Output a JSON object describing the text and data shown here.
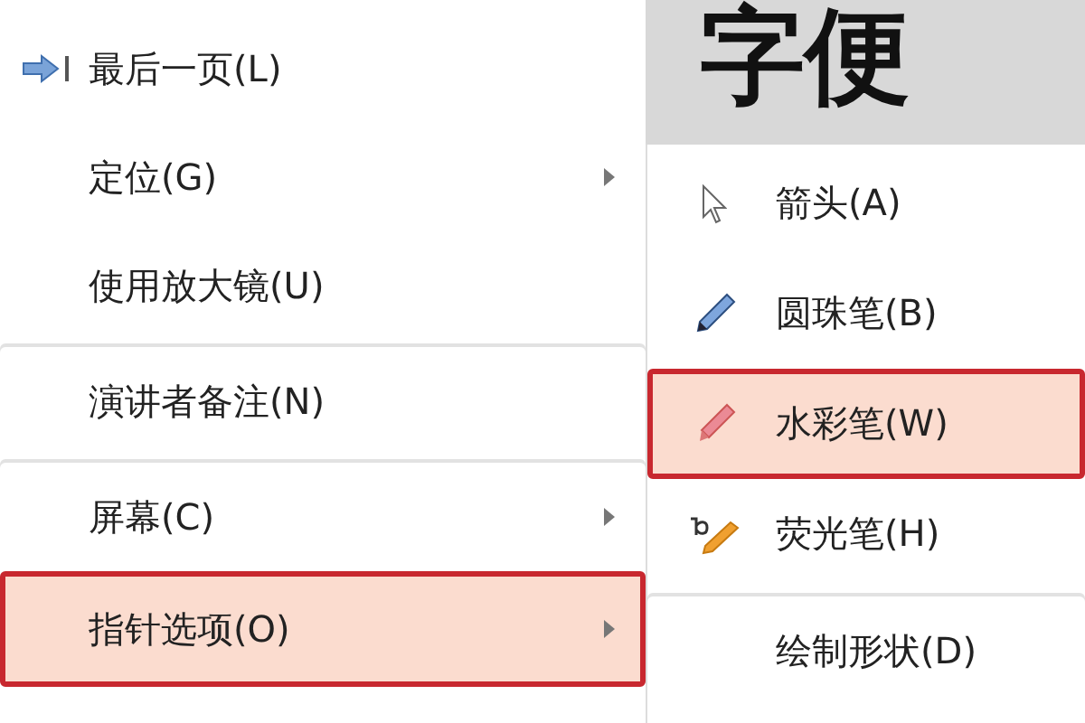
{
  "slide": {
    "title": "字便"
  },
  "menu": {
    "items": [
      {
        "label": "最后一页(L)",
        "submenu": false,
        "selected": false,
        "separator_before": false
      },
      {
        "label": "定位(G)",
        "submenu": true,
        "selected": false,
        "separator_before": false
      },
      {
        "label": "使用放大镜(U)",
        "submenu": false,
        "selected": false,
        "separator_before": false
      },
      {
        "label": "演讲者备注(N)",
        "submenu": false,
        "selected": false,
        "separator_before": true
      },
      {
        "label": "屏幕(C)",
        "submenu": true,
        "selected": false,
        "separator_before": true
      },
      {
        "label": "指针选项(O)",
        "submenu": true,
        "selected": true,
        "separator_before": false
      }
    ]
  },
  "submenu": {
    "items": [
      {
        "label": "箭头(A)",
        "selected": false,
        "separator_before": false
      },
      {
        "label": "圆珠笔(B)",
        "selected": false,
        "separator_before": false
      },
      {
        "label": "水彩笔(W)",
        "selected": true,
        "separator_before": false
      },
      {
        "label": "荧光笔(H)",
        "selected": false,
        "separator_before": false
      },
      {
        "label": "绘制形状(D)",
        "selected": false,
        "separator_before": true
      }
    ]
  }
}
